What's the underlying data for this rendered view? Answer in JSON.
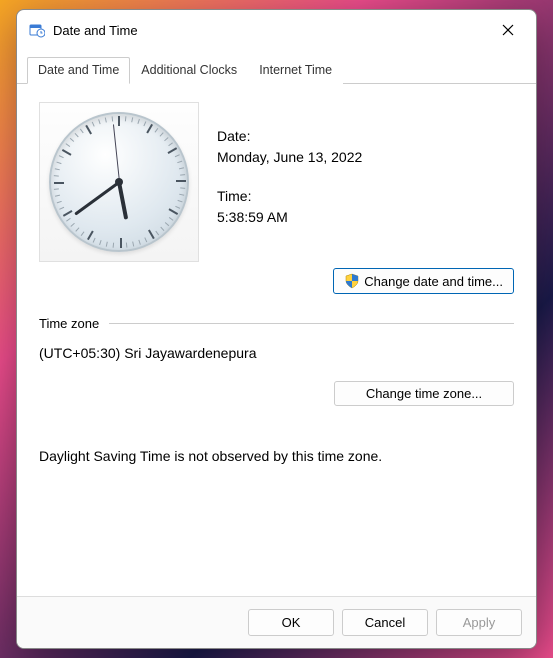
{
  "window": {
    "title": "Date and Time"
  },
  "tabs": {
    "date_time": "Date and Time",
    "additional_clocks": "Additional Clocks",
    "internet_time": "Internet Time"
  },
  "datetime": {
    "date_label": "Date:",
    "date_value": "Monday, June 13, 2022",
    "time_label": "Time:",
    "time_value": "5:38:59 AM",
    "change_button": "Change date and time...",
    "clock": {
      "hours": 5,
      "minutes": 38,
      "seconds": 59
    }
  },
  "timezone": {
    "section_label": "Time zone",
    "value": "(UTC+05:30) Sri Jayawardenepura",
    "change_button": "Change time zone...",
    "dst_note": "Daylight Saving Time is not observed by this time zone."
  },
  "buttons": {
    "ok": "OK",
    "cancel": "Cancel",
    "apply": "Apply"
  }
}
